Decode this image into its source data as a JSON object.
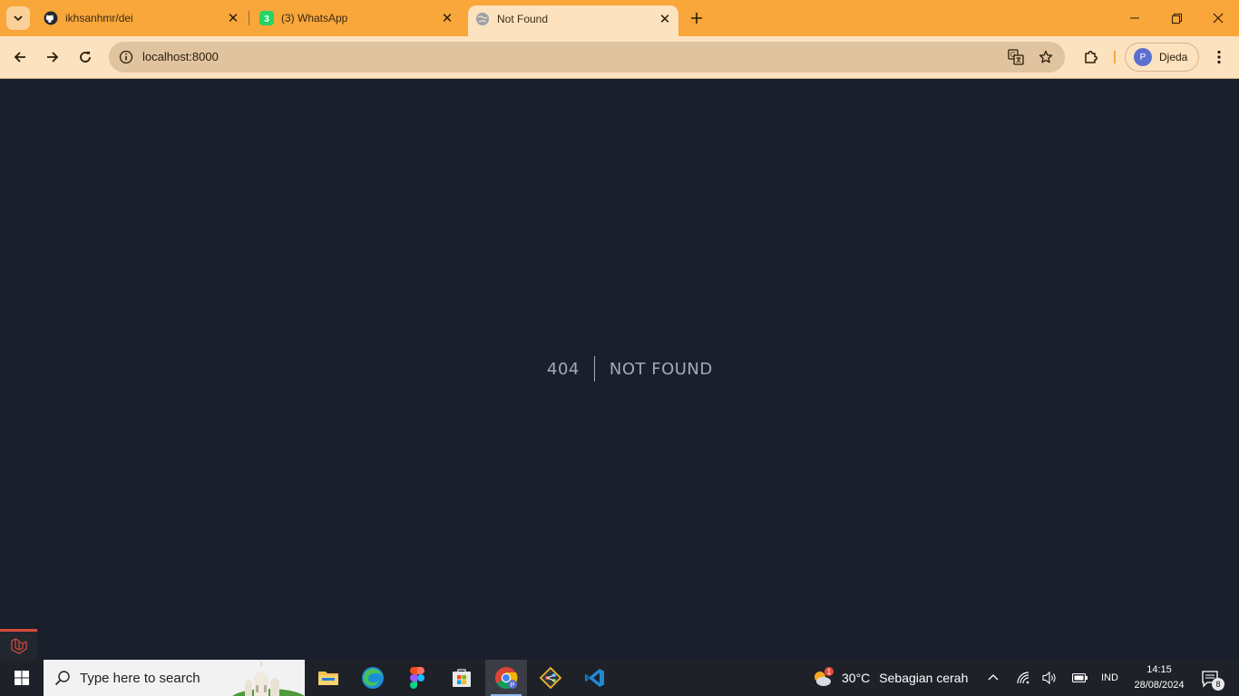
{
  "browser": {
    "tabs": [
      {
        "title": "ikhsanhmr/dei",
        "icon": "github-icon"
      },
      {
        "title": "(3) WhatsApp",
        "icon": "whatsapp-icon",
        "badge": "3"
      },
      {
        "title": "Not Found",
        "icon": "globe-icon",
        "active": true
      }
    ],
    "url": "localhost:8000",
    "profile_name": "Djeda",
    "profile_initial": "P",
    "accent_color": "#f9a63a"
  },
  "page": {
    "error_code": "404",
    "error_message": "NOT FOUND",
    "background_color": "#1b1f2b"
  },
  "taskbar": {
    "search_placeholder": "Type here to search",
    "apps": [
      "file-explorer",
      "edge",
      "figma",
      "microsoft-store",
      "chrome",
      "git",
      "vscode"
    ],
    "weather": {
      "temp": "30°C",
      "condition": "Sebagian cerah",
      "alert_count": "1"
    },
    "language": "IND",
    "time": "14:15",
    "date": "28/08/2024",
    "notification_count": "8"
  }
}
